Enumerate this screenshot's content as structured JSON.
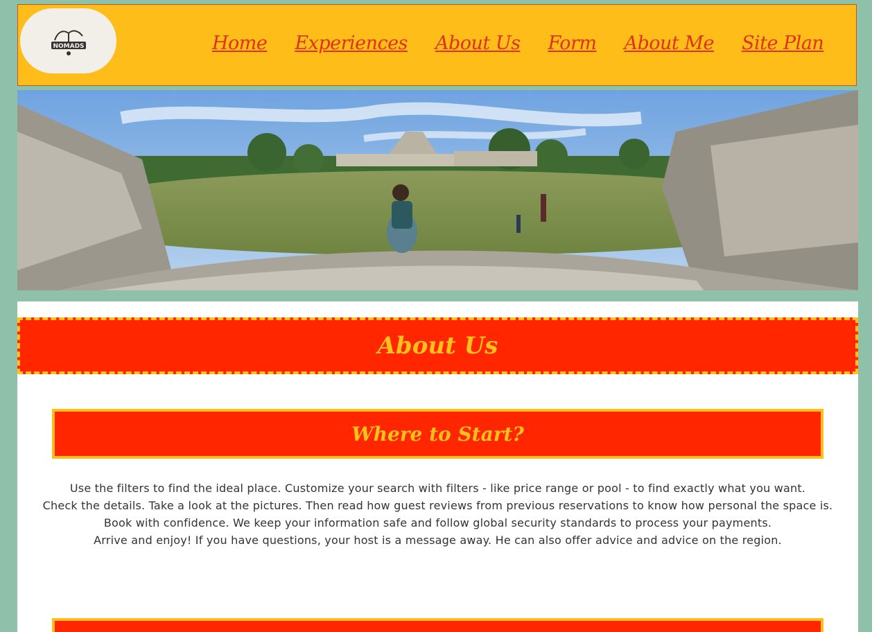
{
  "header": {
    "logo_text": "NOMADS",
    "nav": [
      {
        "label": "Home"
      },
      {
        "label": "Experiences"
      },
      {
        "label": "About Us"
      },
      {
        "label": "Form"
      },
      {
        "label": "About Me"
      },
      {
        "label": "Site Plan"
      }
    ]
  },
  "hero": {
    "icon": "panorama-photo"
  },
  "main": {
    "title": "About Us",
    "section_title": "Where to Start?",
    "paragraphs": [
      "Use the filters to find the ideal place. Customize your search with filters - like price range or pool - to find exactly what you want.",
      "Check the details. Take a look at the pictures. Then read how guest reviews from previous reservations to know how personal the space is.",
      "Book with confidence. We keep your information safe and follow global security standards to process your payments.",
      "Arrive and enjoy! If you have questions, your host is a message away. He can also offer advice and advice on the region."
    ]
  },
  "colors": {
    "page_bg": "#8fc1aa",
    "header_bg": "#ffbd1a",
    "accent_red": "#ff2600",
    "accent_yellow": "#ffc21a"
  }
}
